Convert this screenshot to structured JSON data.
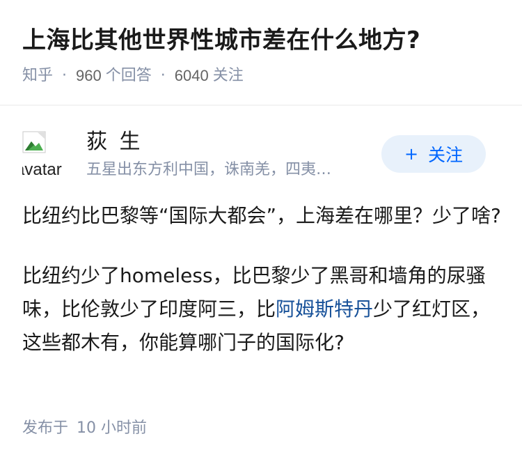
{
  "question": {
    "title": "上海比其他世界性城市差在什么地方?",
    "source": "知乎",
    "separator": "·",
    "answer_count": "960",
    "answer_label": "个回答",
    "follow_count": "6040",
    "follow_label": "关注"
  },
  "answer": {
    "author": {
      "name": "荻 生",
      "bio": "五星出东方利中国，诛南羌，四夷…",
      "avatar_alt": "avatar",
      "avatar_icon": "broken-image-icon"
    },
    "follow_button": {
      "plus": "+",
      "label": "关注"
    },
    "paragraph1": "比纽约比巴黎等“国际大都会”，上海差在哪里？少了啥?",
    "paragraph2_before": "比纽约少了homeless，比巴黎少了黑哥和墙角的尿骚味，比伦敦少了印度阿三，比",
    "paragraph2_link": "阿姆斯特丹",
    "paragraph2_after": "少了红灯区，这些都木有，你能算哪门子的国际化?",
    "post_time_label": "发布于",
    "post_time_value": "10 小时前"
  },
  "colors": {
    "meta": "#8590a6",
    "link": "#175199",
    "button_bg": "#e8f1fb",
    "button_text": "#0066ff"
  }
}
